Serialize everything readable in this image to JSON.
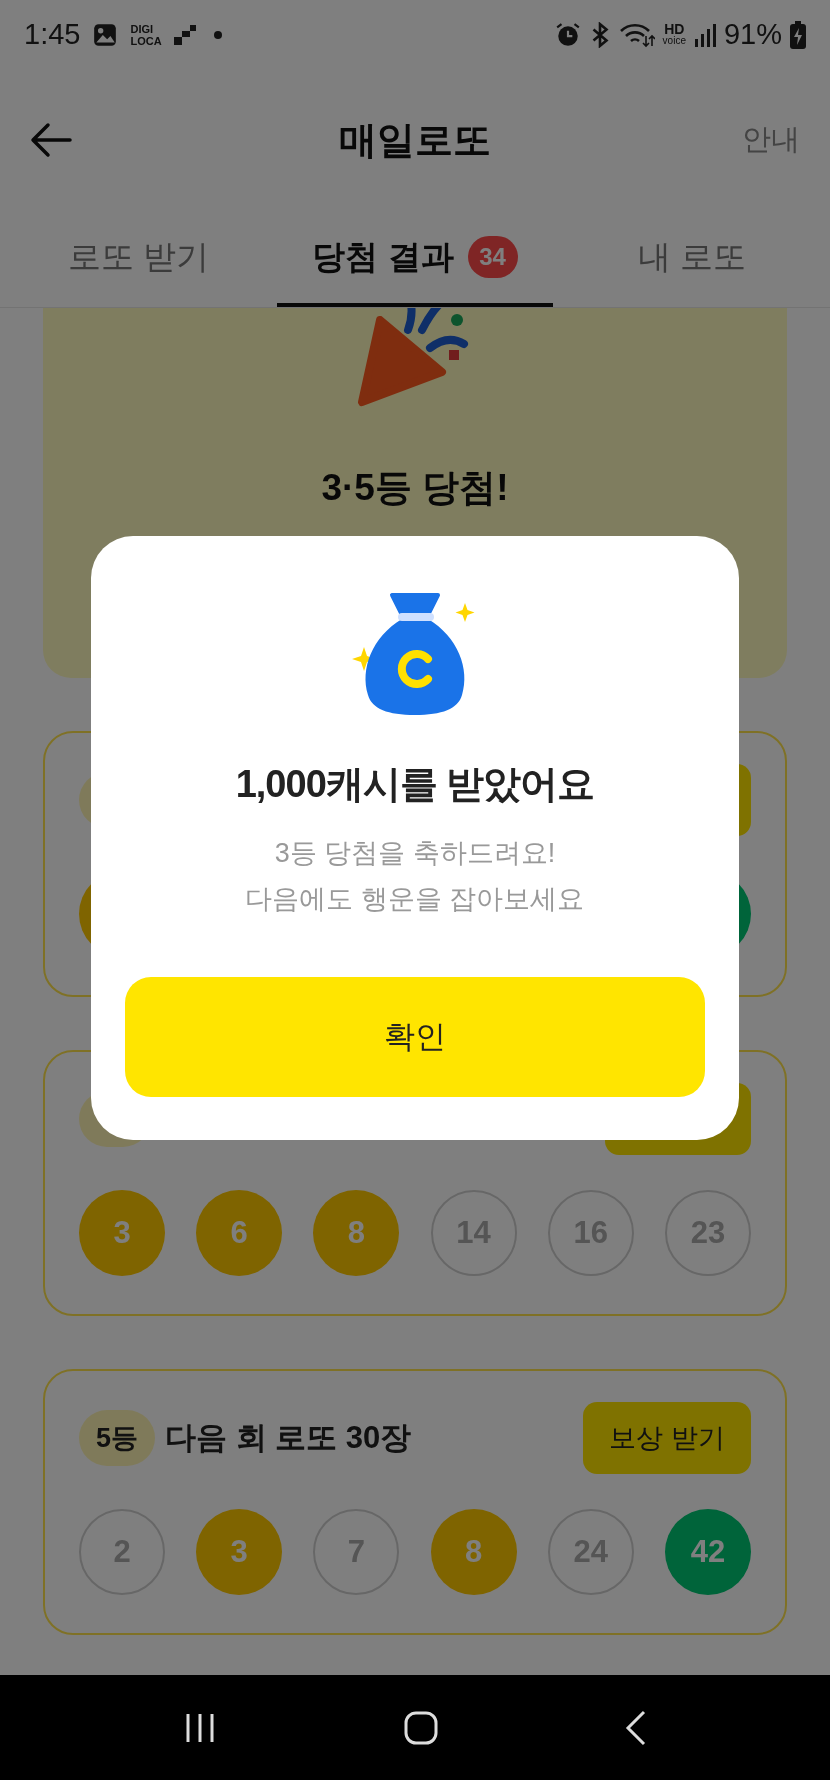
{
  "status_bar": {
    "time": "1:45",
    "notification_text": [
      "DIGI",
      "LOCA"
    ],
    "hd_voice": [
      "HD",
      "voice"
    ],
    "battery": "91%"
  },
  "header": {
    "title": "매일로또",
    "action": "안내"
  },
  "tabs": [
    {
      "label": "로또 받기",
      "selected": false
    },
    {
      "label": "당첨 결과",
      "selected": true,
      "badge": "34"
    },
    {
      "label": "내 로또",
      "selected": false
    }
  ],
  "result_banner": {
    "title": "3·5등 당첨!"
  },
  "tickets": [
    {
      "kind": "covered",
      "balls": [
        {
          "kind": "matched"
        },
        {
          "kind": "bonus"
        }
      ]
    },
    {
      "kind": "covered",
      "balls": [
        {
          "number": "3",
          "kind": "matched"
        },
        {
          "number": "6",
          "kind": "matched"
        },
        {
          "number": "8",
          "kind": "matched"
        },
        {
          "number": "14",
          "kind": "unmatched"
        },
        {
          "number": "16",
          "kind": "unmatched"
        },
        {
          "number": "23",
          "kind": "unmatched"
        }
      ]
    },
    {
      "kind": "full",
      "rank": "5등",
      "prize": "다음 회 로또 30장",
      "button": "보상 받기",
      "balls": [
        {
          "number": "2",
          "kind": "unmatched"
        },
        {
          "number": "3",
          "kind": "matched"
        },
        {
          "number": "7",
          "kind": "unmatched"
        },
        {
          "number": "8",
          "kind": "matched"
        },
        {
          "number": "24",
          "kind": "unmatched"
        },
        {
          "number": "42",
          "kind": "bonus"
        }
      ]
    }
  ],
  "dialog": {
    "title": "1,000캐시를 받았어요",
    "message": [
      "3등 당첨을 축하드려요!",
      "다음에도 행운을 잡아보세요"
    ],
    "button": "확인"
  }
}
